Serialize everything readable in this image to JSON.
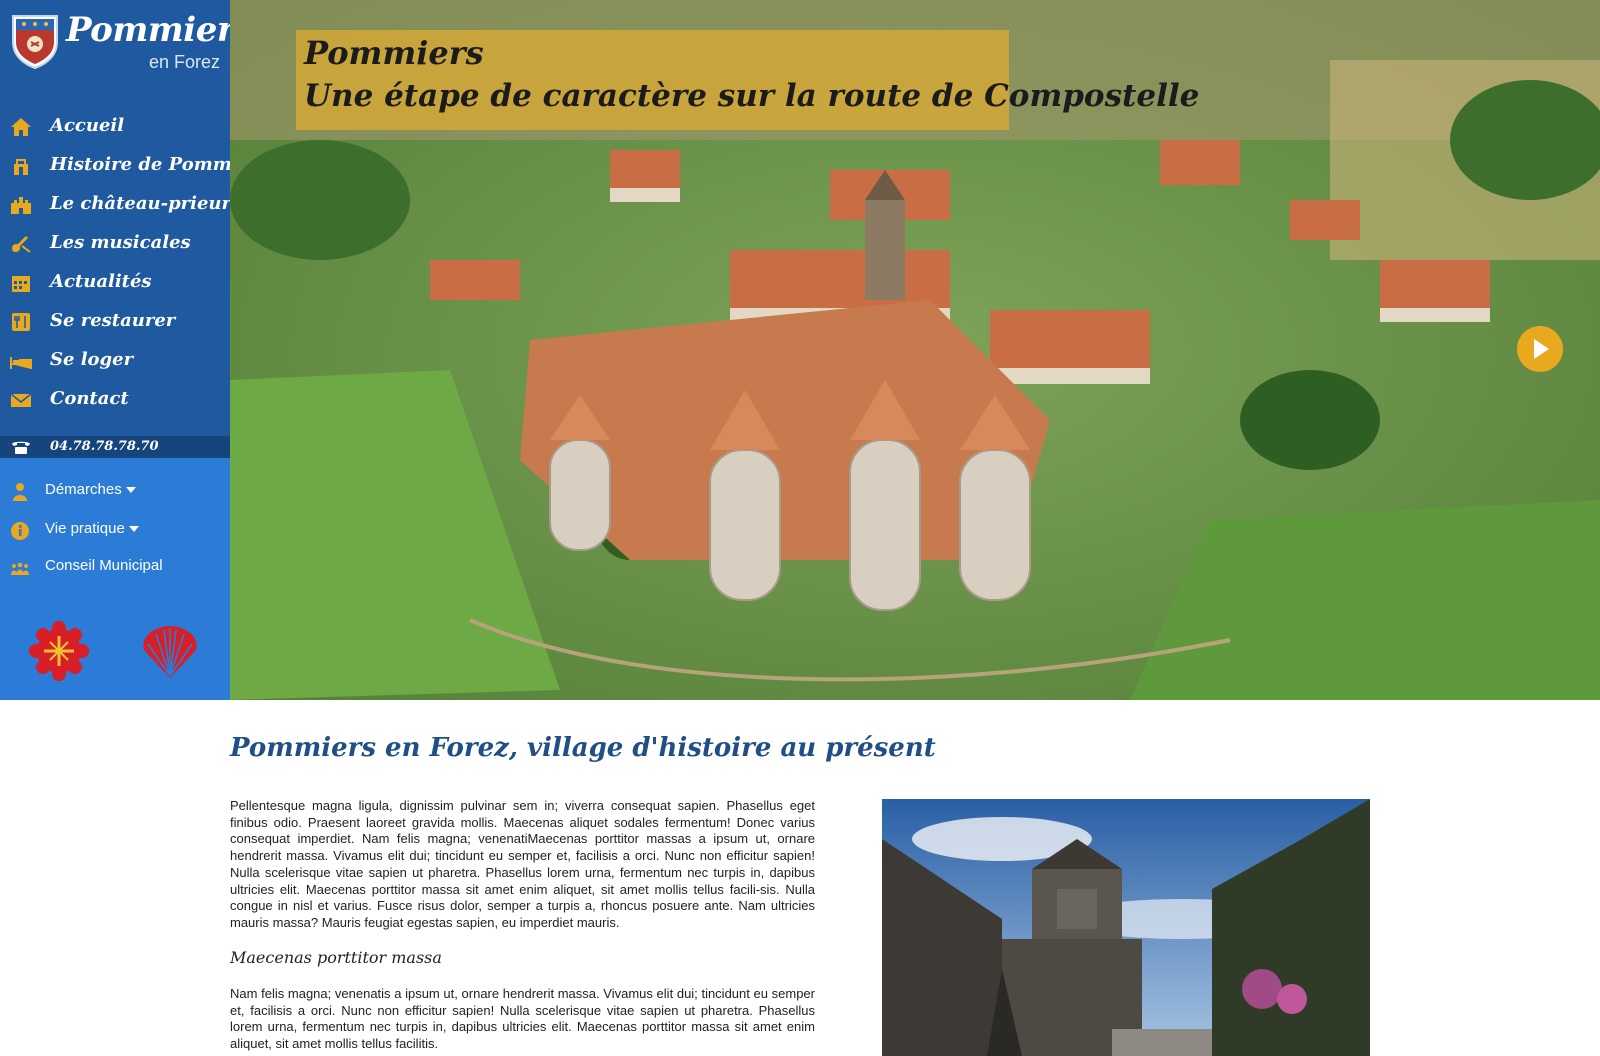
{
  "logo": {
    "title": "Pommiers",
    "subtitle": "en Forez"
  },
  "main_nav": [
    {
      "label": "Accueil",
      "icon": "home-icon"
    },
    {
      "label": "Histoire de Pommiers",
      "icon": "monument-icon"
    },
    {
      "label": "Le château-prieuré",
      "icon": "castle-icon"
    },
    {
      "label": "Les musicales",
      "icon": "music-icon"
    },
    {
      "label": "Actualités",
      "icon": "calendar-icon"
    },
    {
      "label": "Se restaurer",
      "icon": "restaurant-icon"
    },
    {
      "label": "Se loger",
      "icon": "bed-icon"
    },
    {
      "label": "Contact",
      "icon": "envelope-icon"
    }
  ],
  "phone": {
    "number": "04.78.78.78.70",
    "icon": "phone-icon"
  },
  "secondary_nav": [
    {
      "label": "Démarches",
      "icon": "person-icon",
      "has_dropdown": true
    },
    {
      "label": "Vie pratique",
      "icon": "info-icon",
      "has_dropdown": true
    },
    {
      "label": "Conseil Municipal",
      "icon": "group-icon",
      "has_dropdown": false
    }
  ],
  "emblems": [
    "occitan-cross-emblem",
    "scallop-shell-emblem"
  ],
  "hero": {
    "tagline_line1": "Pommiers",
    "tagline_line2": "Une étape de caractère sur la route de Compostelle"
  },
  "content": {
    "title": "Pommiers en Forez, village d'histoire au présent",
    "paragraph1": "Pellentesque magna ligula, dignissim pulvinar sem in; viverra consequat sapien. Phasellus eget finibus odio. Praesent laoreet gravida mollis. Maecenas aliquet sodales fermentum! Donec varius consequat imperdiet. Nam felis magna; venenatiMaecenas porttitor massas a ipsum ut, ornare hendrerit massa. Vivamus elit dui; tincidunt eu semper et, facilisis a orci. Nunc non efficitur sapien! Nulla scelerisque vitae sapien ut pharetra. Phasellus lorem urna, fermentum nec turpis in, dapibus ultricies elit. Maecenas porttitor massa sit amet enim aliquet, sit amet mollis tellus facili-sis. Nulla congue in nisl et varius. Fusce risus dolor, semper a turpis a, rhoncus posuere ante. Nam ultricies mauris massa? Mauris feugiat egestas sapien, eu imperdiet mauris.",
    "subheading": "Maecenas porttitor massa",
    "paragraph2": "Nam felis magna; venenatis a ipsum ut, ornare hendrerit massa. Vivamus elit dui; tincidunt eu semper et, facilisis a orci. Nunc non efficitur sapien! Nulla scelerisque vitae sapien ut pharetra. Phasellus lorem urna, fermentum nec turpis in, dapibus ultricies elit. Maecenas porttitor massa sit amet enim aliquet, sit amet mollis tellus facilitis."
  },
  "colors": {
    "sidebar_dark": "#1f5aa0",
    "sidebar_light": "#2b7bd7",
    "phone_bar": "#16457e",
    "accent": "#e8a91e",
    "title_blue": "#1f4f86",
    "emblem_red": "#d81e27"
  }
}
